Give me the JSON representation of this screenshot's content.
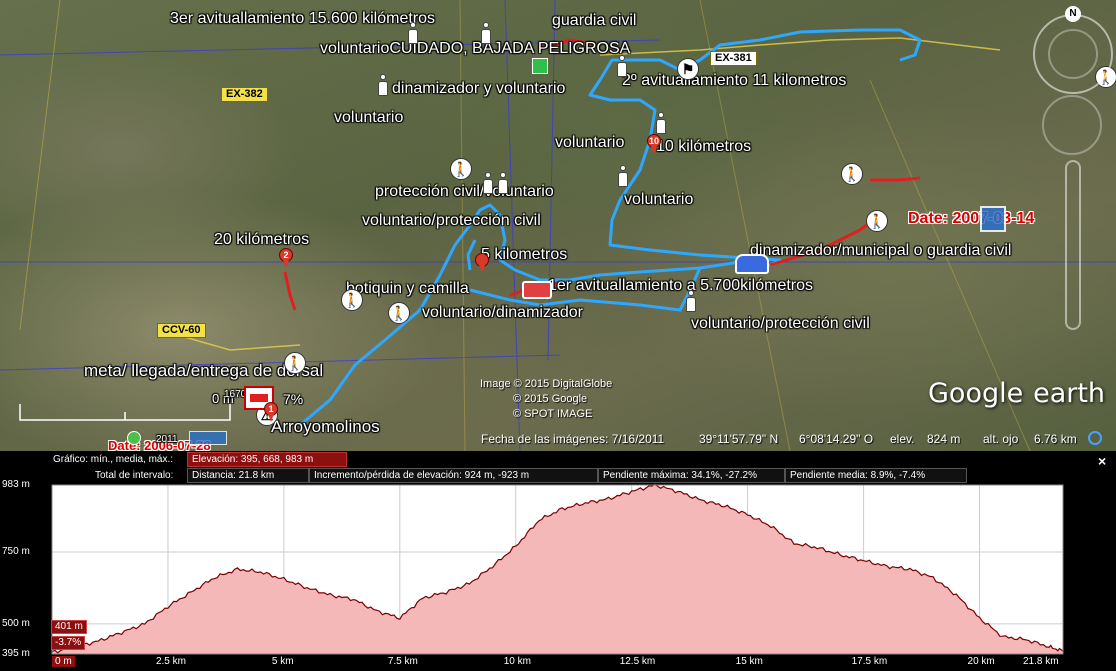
{
  "map": {
    "labels": {
      "avit3": "3er avituallamiento 15.600 kilómetros",
      "guardia": "guardia civil",
      "cuidado": "voluntarioCUIDADO, BAJADA PELIGROSA",
      "avit2": "2º avituallamiento 11 kilometros",
      "dinamizador_vol": "dinamizador y voluntario",
      "voluntario1": "voluntario",
      "voluntario2": "voluntario",
      "km10": "10 kilómetros",
      "proteccion_vol": "protección civil/voluntario",
      "voluntario3": "voluntario",
      "vol_proteccion": "voluntario/protección civil",
      "km20": "20 kilómetros",
      "km5": "5 kilometros",
      "dinam_municipal": "dinamizador/municipal o guardia civil",
      "botiquin": "botiquin y camilla",
      "avit1": "1er avituallamiento a 5.700kilómetros",
      "vol_dinam": "voluntario/dinamizador",
      "vol_prot2": "voluntario/protección civil",
      "meta": "meta/ llegada/entrega de dorsal",
      "arroyo": "Arroyomolinos",
      "scale_0": "0 m",
      "elev_tip": "1670 m",
      "pct": "7%",
      "date1": "Date: 2007-03-14",
      "date2": "Date: 2006-07-28",
      "year": "2011"
    },
    "roads": {
      "ex381": "EX-381",
      "ex382": "EX-382",
      "ccv": "CCV-60"
    },
    "pins": {
      "p1": "1",
      "p2": "2",
      "p3": "",
      "p10": "10"
    },
    "watermark": {
      "line1": "Image © 2015 DigitalGlobe",
      "line2": "© 2015 Google",
      "line3": "© SPOT IMAGE"
    },
    "status": {
      "image_date": "Fecha de las imágenes: 7/16/2011",
      "lat": "39°11'57.79\" N",
      "lon": "6°08'14.29\" O",
      "elev_label": "elev.",
      "elev_value": "824 m",
      "eye_label": "alt. ojo",
      "eye_value": "6.76 km"
    },
    "logo": {
      "google": "Google",
      "earth": "earth"
    },
    "compass_n": "N"
  },
  "profile": {
    "row1_label": "Gráfico: mín., media, máx.:",
    "row1_value": "Elevación: 395, 668, 983 m",
    "row2_label": "Total de intervalo:",
    "distance": "Distancia: 21.8 km",
    "gain": "Incremento/pérdida de elevación: 924 m, -923 m",
    "max_slope": "Pendiente máxima: 34.1%, -27.2%",
    "avg_slope": "Pendiente media: 8.9%, -7.4%",
    "close": "×",
    "y_labels": [
      "983 m",
      "750 m",
      "500 m",
      "395 m"
    ],
    "x_labels": [
      "0 m",
      "2.5 km",
      "5 km",
      "7.5 km",
      "10 km",
      "12.5 km",
      "15 km",
      "17.5 km",
      "20 km",
      "21.8 km"
    ],
    "cursor_elev": "401 m",
    "cursor_slope": "-3.7%",
    "colors": {
      "fill": "#f4b8b8",
      "line": "#7a0000",
      "tag": "#8c1010"
    }
  },
  "chart_data": {
    "type": "area",
    "x": [
      0,
      0.5,
      1,
      1.5,
      2,
      2.5,
      3,
      3.5,
      4,
      4.5,
      5,
      5.5,
      6,
      6.5,
      7,
      7.5,
      8,
      8.5,
      9,
      9.5,
      10,
      10.5,
      11,
      11.5,
      12,
      12.5,
      13,
      13.5,
      14,
      14.5,
      15,
      15.5,
      16,
      16.5,
      17,
      17.5,
      18,
      18.5,
      19,
      19.5,
      20,
      20.5,
      21,
      21.5,
      21.8
    ],
    "values": [
      401,
      420,
      440,
      470,
      500,
      560,
      610,
      660,
      690,
      680,
      655,
      625,
      600,
      585,
      545,
      520,
      590,
      610,
      640,
      700,
      770,
      860,
      900,
      920,
      935,
      960,
      983,
      960,
      930,
      910,
      880,
      840,
      780,
      765,
      740,
      720,
      700,
      690,
      660,
      600,
      520,
      455,
      445,
      420,
      405
    ],
    "xlabel": "",
    "ylabel": "",
    "ylim": [
      395,
      983
    ],
    "xlim": [
      0,
      21.8
    ],
    "grid": true
  }
}
